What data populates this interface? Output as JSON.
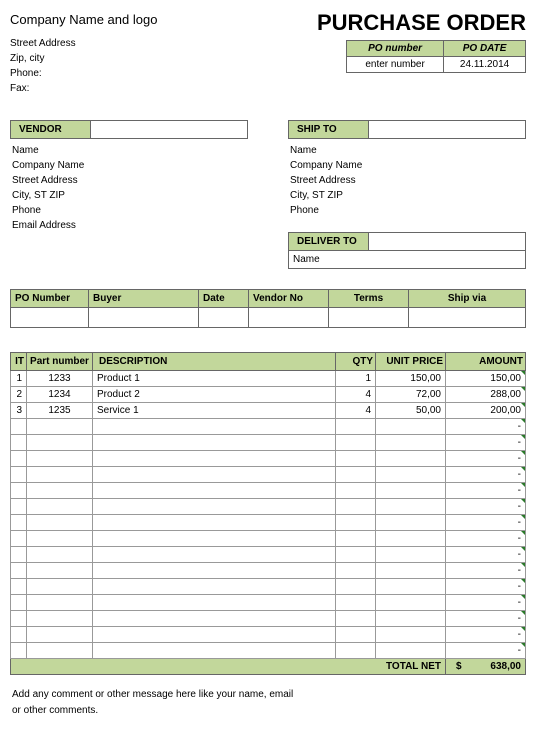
{
  "header": {
    "company_label": "Company Name  and logo",
    "street": "Street Address",
    "zipcity": "Zip, city",
    "phone_label": "Phone:",
    "fax_label": "Fax:",
    "title": "PURCHASE ORDER"
  },
  "po_meta": {
    "number_label": "PO number",
    "date_label": "PO DATE",
    "number_value": "enter number",
    "date_value": "24.11.2014"
  },
  "vendor": {
    "heading": "VENDOR",
    "lines": [
      "Name",
      "Company Name",
      "Street Address",
      "City, ST ZIP",
      "Phone",
      "Email Address"
    ]
  },
  "shipto": {
    "heading": "SHIP TO",
    "lines": [
      "Name",
      "Company Name",
      "Street Address",
      "City, ST ZIP",
      "Phone"
    ]
  },
  "deliver": {
    "heading": "DELIVER TO",
    "name": "Name"
  },
  "po_info": {
    "cols": [
      "PO Number",
      "Buyer",
      "Date",
      "Vendor No",
      "Terms",
      "Ship via"
    ]
  },
  "items": {
    "cols": {
      "item": "IT",
      "part": "Part number",
      "desc": "DESCRIPTION",
      "qty": "QTY",
      "unit": "UNIT PRICE",
      "amount": "AMOUNT"
    },
    "rows": [
      {
        "i": "1",
        "pn": "1233",
        "d": "Product 1",
        "q": "1",
        "u": "150,00",
        "a": "150,00"
      },
      {
        "i": "2",
        "pn": "1234",
        "d": "Product 2",
        "q": "4",
        "u": "72,00",
        "a": "288,00"
      },
      {
        "i": "3",
        "pn": "1235",
        "d": "Service 1",
        "q": "4",
        "u": "50,00",
        "a": "200,00"
      }
    ],
    "dash": "-"
  },
  "total": {
    "label": "TOTAL NET",
    "currency": "$",
    "value": "638,00"
  },
  "comments": {
    "line1": "Add any comment or other message here like your name, email",
    "line2": "or other comments."
  }
}
